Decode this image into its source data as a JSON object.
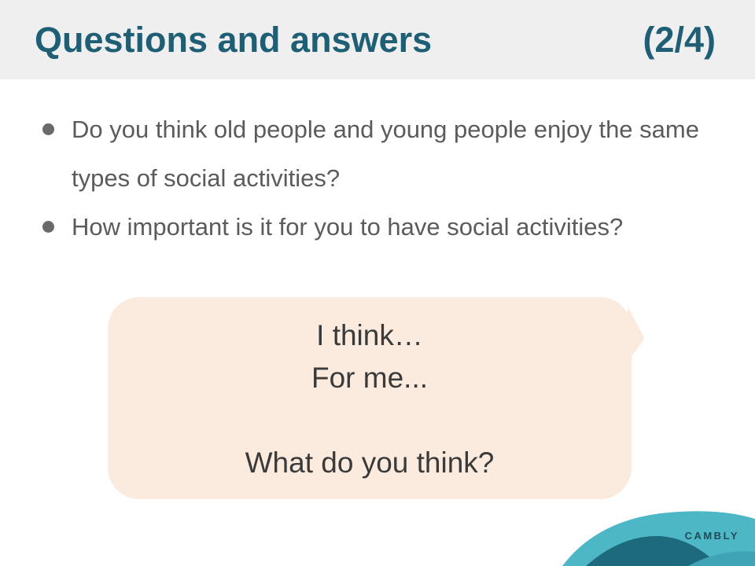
{
  "header": {
    "title": "Questions and answers",
    "page_indicator": "(2/4)"
  },
  "bullets": [
    "Do you think old people and young people enjoy the same types of social activities?",
    "How important is it for you to have social activities?"
  ],
  "bubble": {
    "lines": [
      "I think…",
      "For me...",
      "",
      "What do you think?"
    ]
  },
  "brand": {
    "logo_text": "CAMBLY"
  },
  "colors": {
    "title": "#1f5f75",
    "header_bg": "#efefef",
    "bubble_bg": "#fbebde",
    "wave_light": "#4eb7c6",
    "wave_dark": "#1d6a7c"
  }
}
